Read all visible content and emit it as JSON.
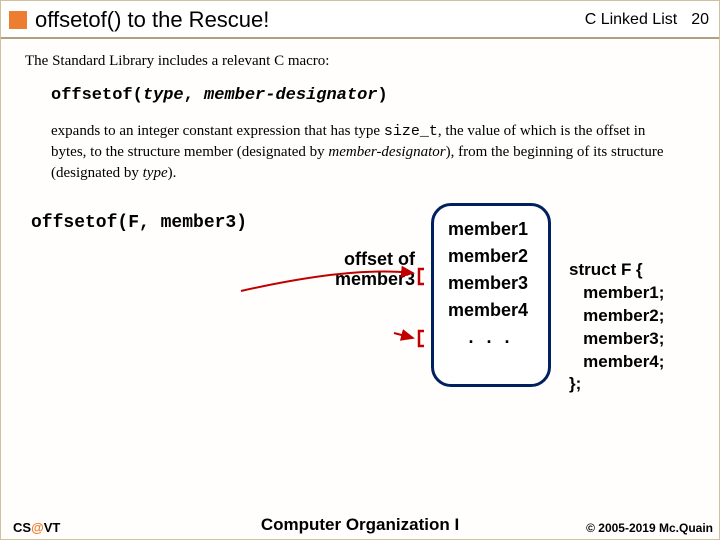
{
  "header": {
    "title": "offsetof() to the Rescue!",
    "topic": "C Linked List",
    "page_num": "20"
  },
  "intro": "The Standard Library includes a relevant C macro:",
  "macro": {
    "name": "offsetof",
    "lparen": "(",
    "arg1": "type",
    "comma": ", ",
    "arg2": "member-designator",
    "rparen": ")"
  },
  "desc": {
    "p1a": "expands to an integer constant expression that has type ",
    "size_t": "size_t",
    "p1b": ", the value of which is the offset in bytes, to the structure member (designated by ",
    "md": "member-designator",
    "p1c": "), from the beginning of its structure (designated by ",
    "tp": "type",
    "p1d": ")."
  },
  "example": {
    "call": "offsetof(F, member3)",
    "offset_label_l1": "offset of",
    "offset_label_l2": "member3",
    "box": {
      "m1": "member1",
      "m2": "member2",
      "m3": "member3",
      "m4": "member4",
      "dots": ". . ."
    },
    "struct_code": "struct F {\n   member1;\n   member2;\n   member3;\n   member4;\n};"
  },
  "footer": {
    "left_cs": "CS",
    "left_at": "@",
    "left_vt": "VT",
    "center": "Computer Organization I",
    "right": "© 2005-2019 Mc.Quain"
  }
}
